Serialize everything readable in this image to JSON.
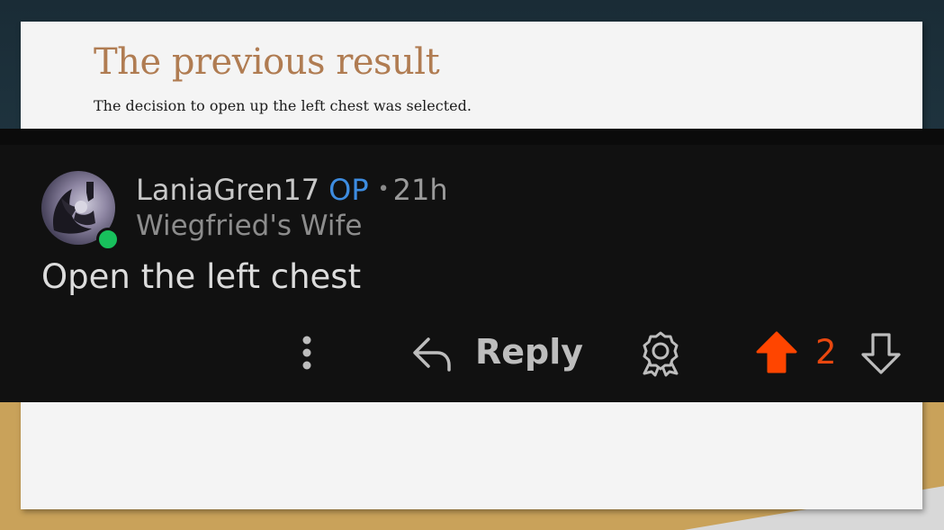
{
  "slide": {
    "title": "The previous result",
    "subtitle": "The decision to open up the left chest was selected."
  },
  "comment": {
    "username": "LaniaGren17",
    "op_badge": "OP",
    "separator": "•",
    "time": "21h",
    "flair": "Wiegfried's Wife",
    "text": "Open the left chest",
    "online": true,
    "actions": {
      "more_icon": "vertical-ellipsis-icon",
      "reply_icon": "reply-arrow-icon",
      "reply_label": "Reply",
      "award_icon": "award-icon",
      "upvote_icon": "upvote-arrow-icon",
      "score": "2",
      "downvote_icon": "downvote-arrow-icon"
    },
    "colors": {
      "op": "#3d8ce0",
      "upvote": "#ff4500",
      "score": "#e8470f",
      "online": "#18c05c"
    }
  }
}
